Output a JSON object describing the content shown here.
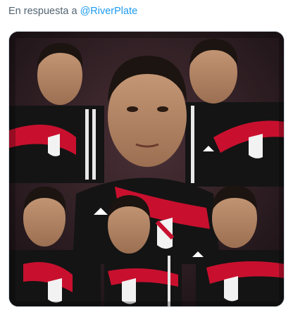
{
  "tweet": {
    "reply_prefix": "En respuesta a",
    "reply_handle": "@RiverPlate"
  },
  "media": {
    "type": "photo-collage",
    "description_icon": "image-icon",
    "colors": {
      "jersey": "#141414",
      "stripe": "#c8102e",
      "skin": "#b58868",
      "hair": "#1c1410",
      "background": "#2a1b1f"
    }
  }
}
